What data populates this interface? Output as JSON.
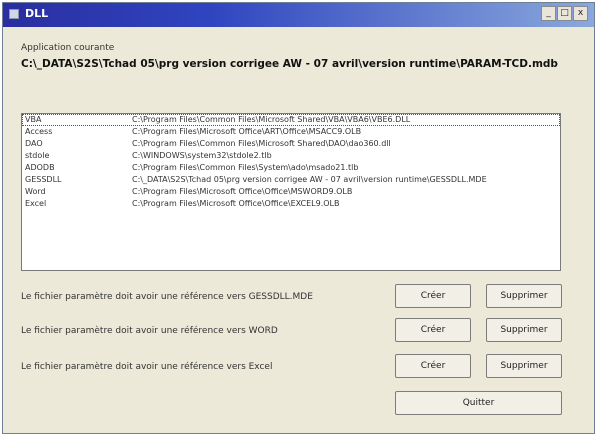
{
  "window": {
    "title": "DLL",
    "controls": {
      "minimize": "_",
      "maximize": "□",
      "close": "x"
    }
  },
  "current_app": {
    "label": "Application courante",
    "path": "C:\\_DATA\\S2S\\Tchad 05\\prg version corrigee AW - 07 avril\\version runtime\\PARAM-TCD.mdb"
  },
  "references": [
    {
      "name": "VBA",
      "path": "C:\\Program Files\\Common Files\\Microsoft Shared\\VBA\\VBA6\\VBE6.DLL"
    },
    {
      "name": "Access",
      "path": "C:\\Program Files\\Microsoft Office\\ART\\Office\\MSACC9.OLB"
    },
    {
      "name": "DAO",
      "path": "C:\\Program Files\\Common Files\\Microsoft Shared\\DAO\\dao360.dll"
    },
    {
      "name": "stdole",
      "path": "C:\\WINDOWS\\system32\\stdole2.tlb"
    },
    {
      "name": "ADODB",
      "path": "C:\\Program Files\\Common Files\\System\\ado\\msado21.tlb"
    },
    {
      "name": "GESSDLL",
      "path": "C:\\_DATA\\S2S\\Tchad 05\\prg version corrigee AW - 07 avril\\version runtime\\GESSDLL.MDE"
    },
    {
      "name": "Word",
      "path": "C:\\Program Files\\Microsoft Office\\Office\\MSWORD9.OLB"
    },
    {
      "name": "Excel",
      "path": "C:\\Program Files\\Microsoft Office\\Office\\EXCEL9.OLB"
    }
  ],
  "requirements": [
    {
      "text": "Le fichier paramètre doit avoir une référence vers GESSDLL.MDE",
      "create": "Créer",
      "delete": "Supprimer"
    },
    {
      "text": "Le fichier paramètre doit avoir une référence vers WORD",
      "create": "Créer",
      "delete": "Supprimer"
    },
    {
      "text": "Le fichier paramètre doit avoir une référence vers Excel",
      "create": "Créer",
      "delete": "Supprimer"
    }
  ],
  "quit_label": "Quitter"
}
